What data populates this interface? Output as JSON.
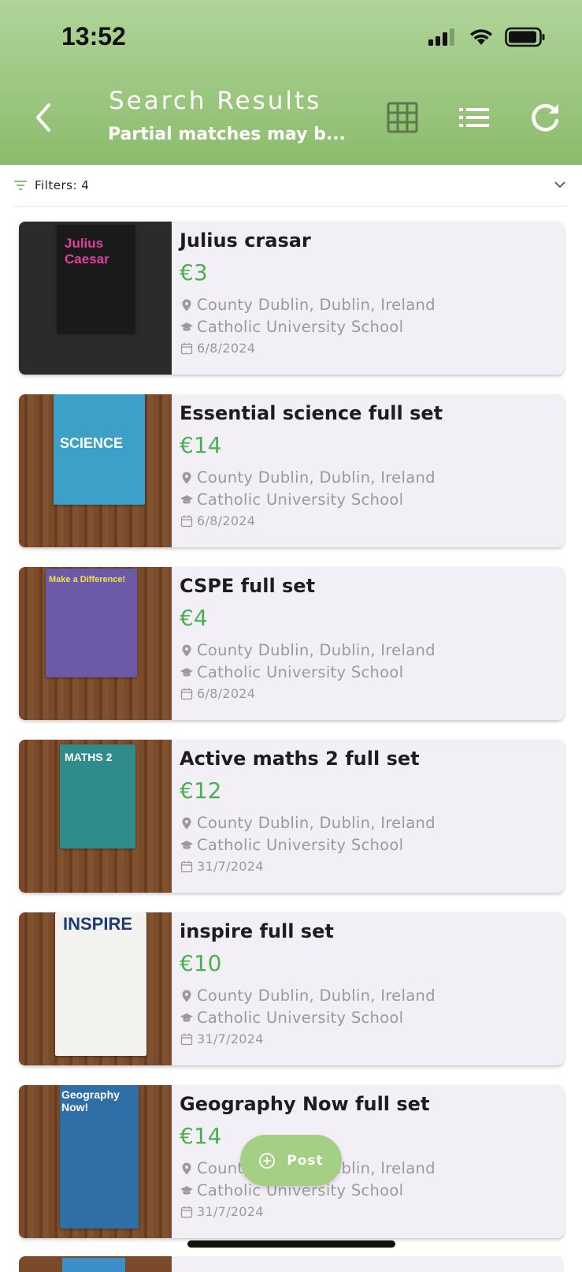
{
  "status": {
    "time": "13:52"
  },
  "header": {
    "title": "Search Results",
    "subtitle": "Partial matches may b..."
  },
  "filters": {
    "label": "Filters: 4"
  },
  "colors": {
    "header_top": "#b0d49a",
    "header_bottom": "#8cbc6c",
    "price": "#4caf50",
    "card": "#f3eff7",
    "fab": "#a4cf85"
  },
  "icons": {
    "back": "chevron-left-icon",
    "grid": "grid-view-icon",
    "list": "list-view-icon",
    "refresh": "refresh-icon",
    "filter": "filter-icon",
    "expand": "chevron-down-icon",
    "location": "location-pin-icon",
    "school": "graduation-cap-icon",
    "date": "calendar-icon",
    "post": "plus-circle-icon"
  },
  "listings": [
    {
      "title": "Julius crasar",
      "price": "€3",
      "location": "County Dublin, Dublin, Ireland",
      "school": "Catholic University School",
      "date": "6/8/2024",
      "cover_text": "Julius Caesar"
    },
    {
      "title": "Essential science full set",
      "price": "€14",
      "location": "County Dublin, Dublin, Ireland",
      "school": "Catholic University School",
      "date": "6/8/2024",
      "cover_text": "SCIENCE"
    },
    {
      "title": "CSPE full set",
      "price": "€4",
      "location": "County Dublin, Dublin, Ireland",
      "school": "Catholic University School",
      "date": "6/8/2024",
      "cover_text": "Make a Difference!"
    },
    {
      "title": "Active maths 2 full set",
      "price": "€12",
      "location": "County Dublin, Dublin, Ireland",
      "school": "Catholic University School",
      "date": "31/7/2024",
      "cover_text": "MATHS 2"
    },
    {
      "title": "inspire full set",
      "price": "€10",
      "location": "County Dublin, Dublin, Ireland",
      "school": "Catholic University School",
      "date": "31/7/2024",
      "cover_text": "INSPIRE"
    },
    {
      "title": "Geography Now full set",
      "price": "€14",
      "location": "County Dublin, Dublin, Ireland",
      "school": "Catholic University School",
      "date": "31/7/2024",
      "cover_text": "Geography Now!"
    }
  ],
  "fab": {
    "label": "Post"
  }
}
